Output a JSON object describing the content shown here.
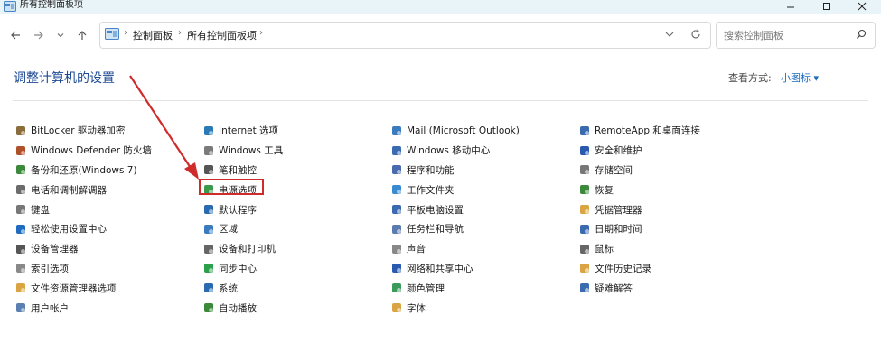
{
  "window": {
    "title": "所有控制面板项"
  },
  "address": {
    "crumbs": [
      "控制面板",
      "所有控制面板项"
    ]
  },
  "search": {
    "placeholder": "搜索控制面板"
  },
  "header": {
    "title": "调整计算机的设置",
    "view_by_label": "查看方式:",
    "view_by_value": "小图标 ▾"
  },
  "columns": [
    [
      {
        "label": "BitLocker 驱动器加密",
        "icon": "bitlocker-icon",
        "color": "#8a6d3b"
      },
      {
        "label": "Windows Defender 防火墙",
        "icon": "firewall-icon",
        "color": "#b0502a"
      },
      {
        "label": "备份和还原(Windows 7)",
        "icon": "backup-icon",
        "color": "#3b8a3b"
      },
      {
        "label": "电话和调制解调器",
        "icon": "phone-modem-icon",
        "color": "#6b6b6b"
      },
      {
        "label": "键盘",
        "icon": "keyboard-icon",
        "color": "#777777"
      },
      {
        "label": "轻松使用设置中心",
        "icon": "ease-of-access-icon",
        "color": "#1e6bbf"
      },
      {
        "label": "设备管理器",
        "icon": "device-manager-icon",
        "color": "#555555"
      },
      {
        "label": "索引选项",
        "icon": "indexing-icon",
        "color": "#888888"
      },
      {
        "label": "文件资源管理器选项",
        "icon": "folder-options-icon",
        "color": "#d9a441"
      },
      {
        "label": "用户帐户",
        "icon": "user-accounts-icon",
        "color": "#5a7fb0"
      }
    ],
    [
      {
        "label": "Internet 选项",
        "icon": "internet-options-icon",
        "color": "#2a7ab8"
      },
      {
        "label": "Windows 工具",
        "icon": "windows-tools-icon",
        "color": "#7a7a7a"
      },
      {
        "label": "笔和触控",
        "icon": "pen-touch-icon",
        "color": "#555555"
      },
      {
        "label": "电源选项",
        "icon": "power-options-icon",
        "color": "#3a9a4a"
      },
      {
        "label": "默认程序",
        "icon": "default-programs-icon",
        "color": "#2a6ab0"
      },
      {
        "label": "区域",
        "icon": "region-icon",
        "color": "#3a7abf"
      },
      {
        "label": "设备和打印机",
        "icon": "devices-printers-icon",
        "color": "#666666"
      },
      {
        "label": "同步中心",
        "icon": "sync-center-icon",
        "color": "#2aa04a"
      },
      {
        "label": "系统",
        "icon": "system-icon",
        "color": "#2a6ab0"
      },
      {
        "label": "自动播放",
        "icon": "autoplay-icon",
        "color": "#3a8a3a"
      }
    ],
    [
      {
        "label": "Mail (Microsoft Outlook)",
        "icon": "mail-icon",
        "color": "#3a7abf"
      },
      {
        "label": "Windows 移动中心",
        "icon": "mobility-center-icon",
        "color": "#3a6ab0"
      },
      {
        "label": "程序和功能",
        "icon": "programs-features-icon",
        "color": "#4a6ab0"
      },
      {
        "label": "工作文件夹",
        "icon": "work-folders-icon",
        "color": "#3a8ad0"
      },
      {
        "label": "平板电脑设置",
        "icon": "tablet-settings-icon",
        "color": "#3a6ab0"
      },
      {
        "label": "任务栏和导航",
        "icon": "taskbar-icon",
        "color": "#5a7ab0"
      },
      {
        "label": "声音",
        "icon": "sound-icon",
        "color": "#888888"
      },
      {
        "label": "网络和共享中心",
        "icon": "network-icon",
        "color": "#2a5ab0"
      },
      {
        "label": "颜色管理",
        "icon": "color-management-icon",
        "color": "#3a9a5a"
      },
      {
        "label": "字体",
        "icon": "fonts-icon",
        "color": "#d9a441"
      }
    ],
    [
      {
        "label": "RemoteApp 和桌面连接",
        "icon": "remoteapp-icon",
        "color": "#3a6ab0"
      },
      {
        "label": "安全和维护",
        "icon": "security-maintenance-icon",
        "color": "#2a5ab0"
      },
      {
        "label": "存储空间",
        "icon": "storage-spaces-icon",
        "color": "#777777"
      },
      {
        "label": "恢复",
        "icon": "recovery-icon",
        "color": "#3a8a3a"
      },
      {
        "label": "凭据管理器",
        "icon": "credential-manager-icon",
        "color": "#d9a441"
      },
      {
        "label": "日期和时间",
        "icon": "date-time-icon",
        "color": "#3a6ab0"
      },
      {
        "label": "鼠标",
        "icon": "mouse-icon",
        "color": "#666666"
      },
      {
        "label": "文件历史记录",
        "icon": "file-history-icon",
        "color": "#d9a441"
      },
      {
        "label": "疑难解答",
        "icon": "troubleshooting-icon",
        "color": "#3a6ab0"
      }
    ]
  ]
}
